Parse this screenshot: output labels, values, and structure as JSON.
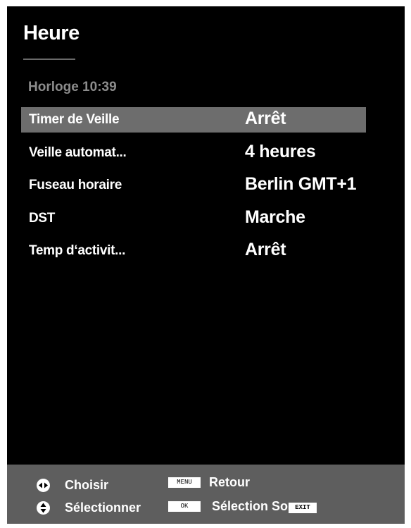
{
  "header": {
    "title": "Heure",
    "clock": "Horloge 10:39"
  },
  "menu": {
    "items": [
      {
        "label": "Timer de Veille",
        "value": "Arrêt",
        "selected": true
      },
      {
        "label": "Veille automat...",
        "value": "4 heures",
        "selected": false
      },
      {
        "label": "Fuseau horaire",
        "value": "Berlin GMT+1",
        "selected": false
      },
      {
        "label": "DST",
        "value": "Marche",
        "selected": false
      },
      {
        "label": "Temp d‘activit...",
        "value": "Arrêt",
        "selected": false
      }
    ]
  },
  "footer": {
    "choose_label": "Choisir",
    "choose_icon": "left-right-arrows-icon",
    "select_label": "Sélectionner",
    "select_icon": "up-down-arrows-icon",
    "menu_key": "MENU",
    "back_label": "Retour",
    "ok_key": "OK",
    "selection_label": "Sélection So",
    "exit_key": "EXIT"
  },
  "colors": {
    "background": "#000000",
    "selected_row": "#6d6d6d",
    "footer": "#5e5e5e",
    "dim_text": "#8c8c8c",
    "text": "#ffffff"
  }
}
